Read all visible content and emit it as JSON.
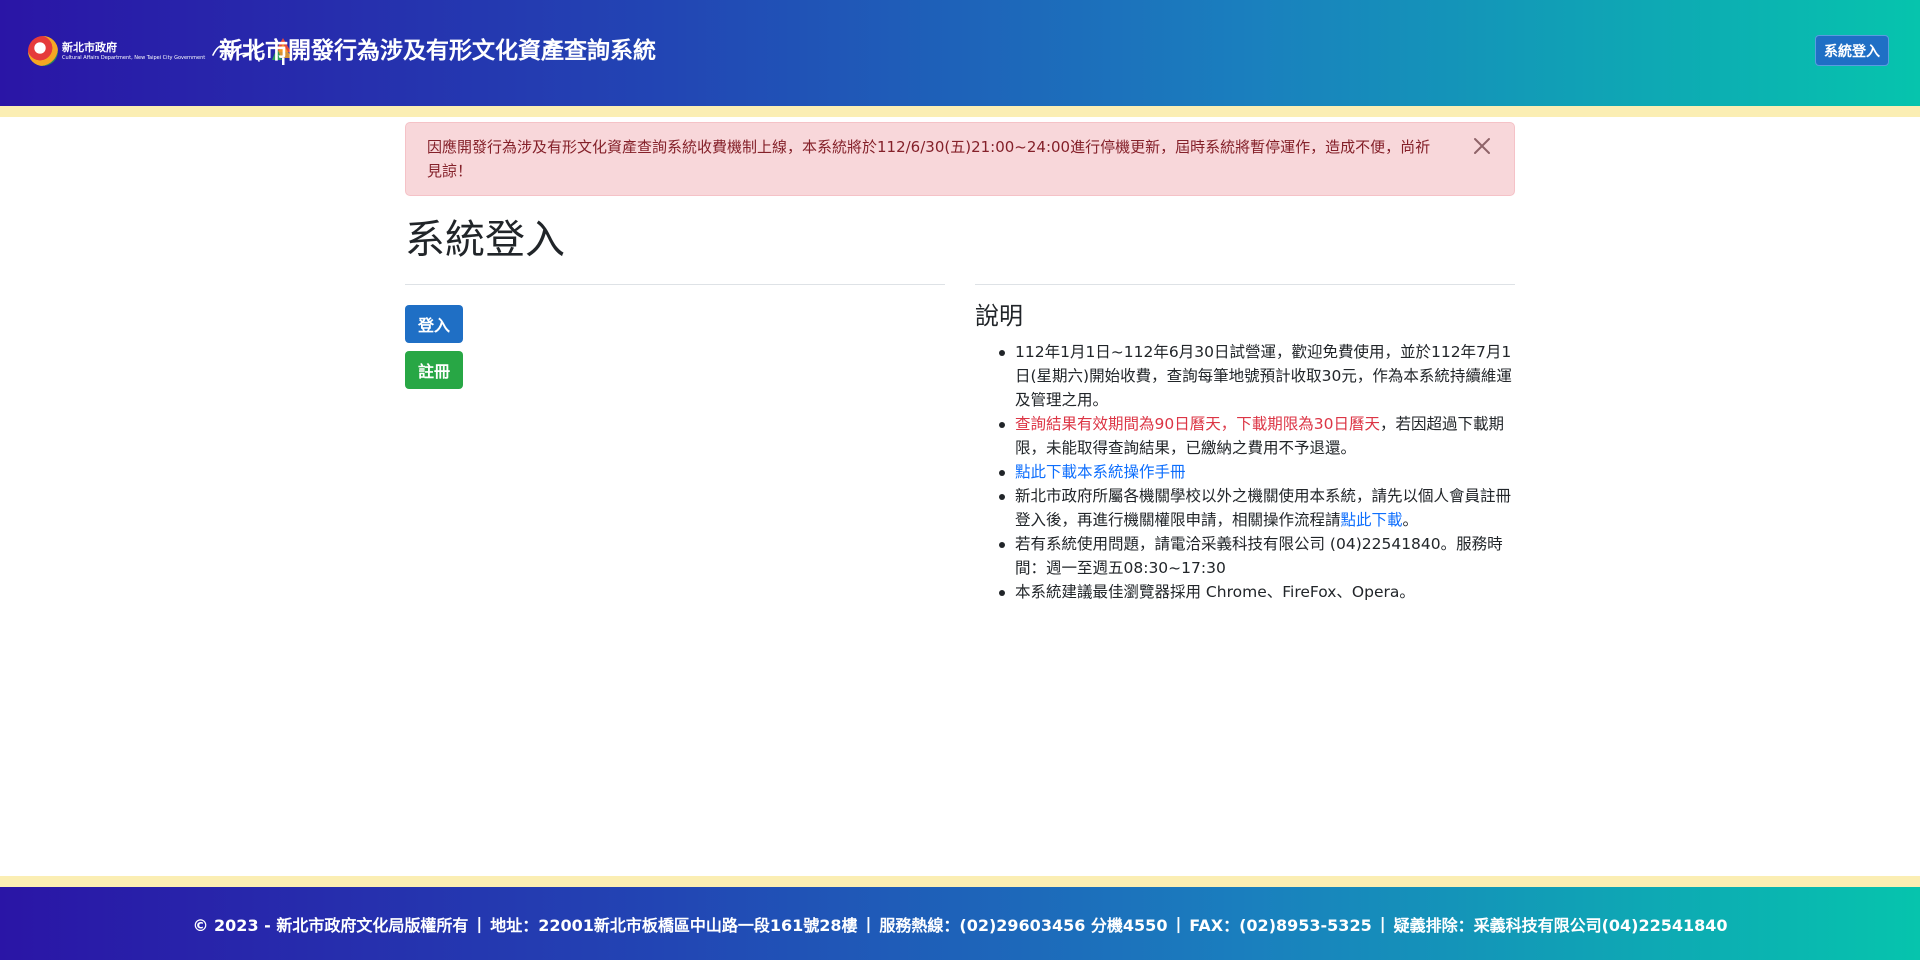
{
  "header": {
    "logo_cn": "新北市政府",
    "logo_en": "Cultural Affairs Department, New Taipei City Government",
    "site_title": "新北市開發行為涉及有形文化資產查詢系統",
    "login_button": "系統登入"
  },
  "alert": {
    "message": "因應開發行為涉及有形文化資產查詢系統收費機制上線，本系統將於112/6/30(五)21:00~24:00進行停機更新，屆時系統將暫停運作，造成不便，尚祈見諒！",
    "close_icon": "close-icon"
  },
  "main": {
    "page_title": "系統登入",
    "login_button": "登入",
    "register_button": "註冊"
  },
  "info": {
    "title": "說明",
    "item1": "112年1月1日~112年6月30日試營運，歡迎免費使用，並於112年7月1日(星期六)開始收費，查詢每筆地號預計收取30元，作為本系統持續維運及管理之用。",
    "item2_red": "查詢結果有效期間為90日曆天，下載期限為30日曆天",
    "item2_rest": "，若因超過下載期限，未能取得查詢結果，已繳納之費用不予退還。",
    "item3_link": "點此下載本系統操作手冊",
    "item4_text": "新北市政府所屬各機關學校以外之機關使用本系統，請先以個人會員註冊登入後，再進行機關權限申請，相關操作流程請",
    "item4_link": "點此下載",
    "item4_end": "。",
    "item5": "若有系統使用問題，請電洽采義科技有限公司 (04)22541840。服務時間：週一至週五08:30~17:30",
    "item6": "本系統建議最佳瀏覽器採用 Chrome、FireFox、Opera。"
  },
  "footer": {
    "copyright": "© 2023 - 新北市政府文化局版權所有",
    "address": "地址：22001新北市板橋區中山路一段161號28樓",
    "hotline": "服務熱線：(02)29603456 分機4550",
    "fax": "FAX：(02)8953-5325",
    "support": "疑義排除：采義科技有限公司(04)22541840"
  },
  "colors": {
    "primary": "#1f6fc5",
    "success": "#28a745",
    "alert_bg": "#f8d7da",
    "alert_text": "#842029",
    "accent_red": "#dc3545",
    "link": "#0d6efd",
    "stripe": "#fbeeb3"
  }
}
